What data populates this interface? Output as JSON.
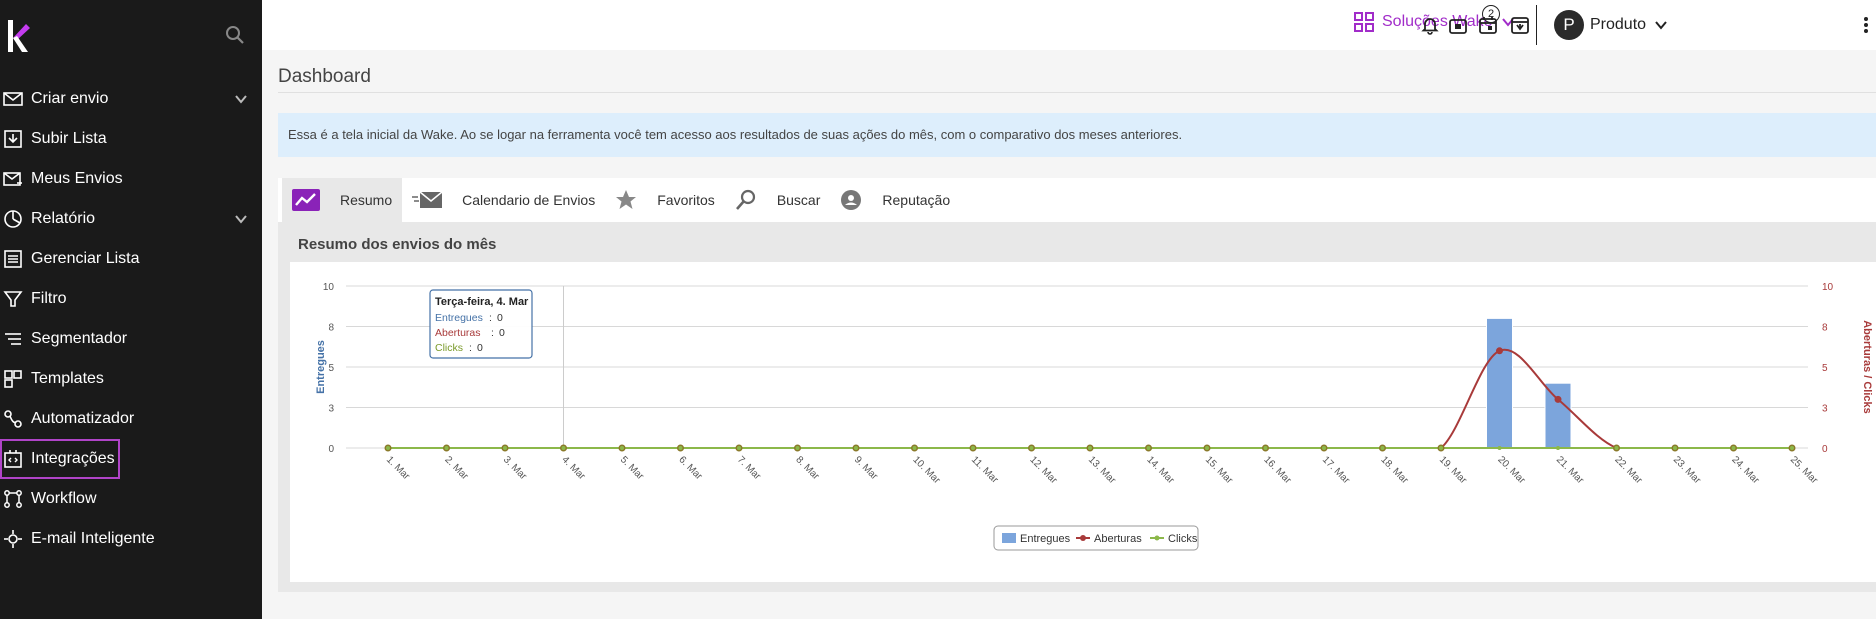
{
  "sidebar": {
    "items": [
      {
        "label": "Criar envio",
        "icon": "mail-icon",
        "has_chevron": true
      },
      {
        "label": "Subir Lista",
        "icon": "upload-list-icon",
        "has_chevron": false
      },
      {
        "label": "Meus Envios",
        "icon": "sent-mail-icon",
        "has_chevron": false
      },
      {
        "label": "Relatório",
        "icon": "pie-chart-icon",
        "has_chevron": true
      },
      {
        "label": "Gerenciar Lista",
        "icon": "list-icon",
        "has_chevron": false
      },
      {
        "label": "Filtro",
        "icon": "filter-icon",
        "has_chevron": false
      },
      {
        "label": "Segmentador",
        "icon": "segment-icon",
        "has_chevron": false
      },
      {
        "label": "Templates",
        "icon": "templates-icon",
        "has_chevron": false
      },
      {
        "label": "Automatizador",
        "icon": "automation-icon",
        "has_chevron": false
      },
      {
        "label": "Integrações",
        "icon": "integration-icon",
        "has_chevron": false,
        "highlighted": true
      },
      {
        "label": "Workflow",
        "icon": "workflow-icon",
        "has_chevron": false
      },
      {
        "label": "E-mail Inteligente",
        "icon": "smart-mail-icon",
        "has_chevron": false
      }
    ]
  },
  "topbar": {
    "brand": "Soluções Wake",
    "user_initial": "P",
    "user_name": "Produto",
    "notifications_badge": "2"
  },
  "main": {
    "title": "Dashboard",
    "info_text": "Essa é a tela inicial da Wake. Ao se logar na ferramenta você tem acesso aos resultados de suas ações do mês, com o comparativo dos meses anteriores.",
    "tabs": [
      {
        "label": "Resumo",
        "icon": "trend-chart-icon",
        "active": true
      },
      {
        "label": "Calendario de Envios",
        "icon": "envelope-fast-icon",
        "active": false
      },
      {
        "label": "Favoritos",
        "icon": "star-icon",
        "active": false
      },
      {
        "label": "Buscar",
        "icon": "search-icon",
        "active": false
      },
      {
        "label": "Reputação",
        "icon": "reputation-icon",
        "active": false
      }
    ],
    "panel_title": "Resumo dos envios do mês"
  },
  "colors": {
    "accent": "#a12cc9",
    "entregues": "#7ca5dc",
    "aberturas": "#a83a3a",
    "clicks": "#8cb84a"
  },
  "chart_data": {
    "type": "bar",
    "categories": [
      "1. Mar",
      "2. Mar",
      "3. Mar",
      "4. Mar",
      "5. Mar",
      "6. Mar",
      "7. Mar",
      "8. Mar",
      "9. Mar",
      "10. Mar",
      "11. Mar",
      "12. Mar",
      "13. Mar",
      "14. Mar",
      "15. Mar",
      "16. Mar",
      "17. Mar",
      "18. Mar",
      "19. Mar",
      "20. Mar",
      "21. Mar",
      "22. Mar",
      "23. Mar",
      "24. Mar",
      "25. Mar"
    ],
    "series": [
      {
        "name": "Entregues",
        "type": "bar",
        "axis": "left",
        "values": [
          0,
          0,
          0,
          0,
          0,
          0,
          0,
          0,
          0,
          0,
          0,
          0,
          0,
          0,
          0,
          0,
          0,
          0,
          0,
          8,
          4,
          0,
          0,
          0,
          0
        ]
      },
      {
        "name": "Aberturas",
        "type": "line",
        "axis": "right",
        "values": [
          0,
          0,
          0,
          0,
          0,
          0,
          0,
          0,
          0,
          0,
          0,
          0,
          0,
          0,
          0,
          0,
          0,
          0,
          0,
          6,
          3,
          0,
          0,
          0,
          0
        ]
      },
      {
        "name": "Clicks",
        "type": "line",
        "axis": "right",
        "values": [
          0,
          0,
          0,
          0,
          0,
          0,
          0,
          0,
          0,
          0,
          0,
          0,
          0,
          0,
          0,
          0,
          0,
          0,
          0,
          0,
          0,
          0,
          0,
          0,
          0
        ]
      }
    ],
    "ylabel_left": "Entregues",
    "ylabel_right": "Aberturas / Clicks",
    "yticks": [
      "0",
      "3",
      "5",
      "8",
      "10"
    ],
    "ylim": [
      0,
      10
    ],
    "grid": true,
    "legend": "bottom-center",
    "tooltip": {
      "title": "Terça-feira, 4. Mar",
      "rows": [
        {
          "label": "Entregues",
          "value": "0"
        },
        {
          "label": "Aberturas",
          "value": "0"
        },
        {
          "label": "Clicks",
          "value": "0"
        }
      ]
    }
  }
}
